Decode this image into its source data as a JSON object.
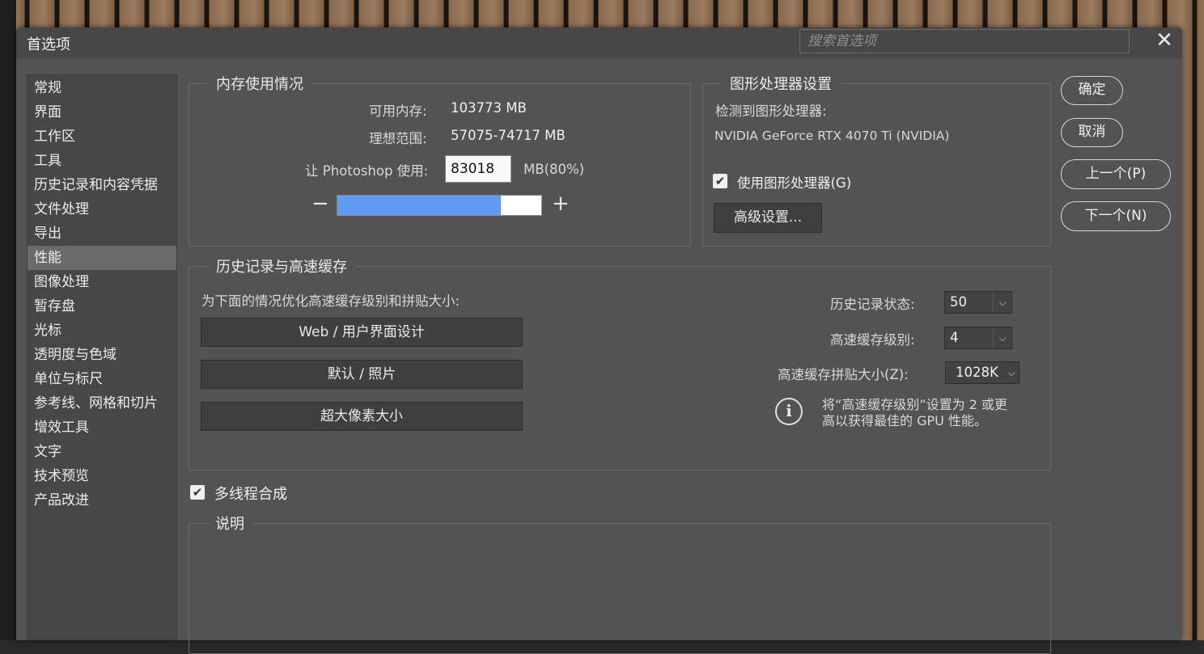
{
  "dialog": {
    "title": "首选项",
    "search_placeholder": "搜索首选项",
    "close_glyph": "✕"
  },
  "sidebar": {
    "items": [
      {
        "label": "常规"
      },
      {
        "label": "界面"
      },
      {
        "label": "工作区"
      },
      {
        "label": "工具"
      },
      {
        "label": "历史记录和内容凭据"
      },
      {
        "label": "文件处理"
      },
      {
        "label": "导出"
      },
      {
        "label": "性能",
        "active": true
      },
      {
        "label": "图像处理"
      },
      {
        "label": "暂存盘"
      },
      {
        "label": "光标"
      },
      {
        "label": "透明度与色域"
      },
      {
        "label": "单位与标尺"
      },
      {
        "label": "参考线、网格和切片"
      },
      {
        "label": "增效工具"
      },
      {
        "label": "文字"
      },
      {
        "label": "技术预览"
      },
      {
        "label": "产品改进"
      }
    ]
  },
  "memory": {
    "legend": "内存使用情况",
    "available_label": "可用内存:",
    "available_value": "103773 MB",
    "ideal_label": "理想范围:",
    "ideal_value": "57075-74717 MB",
    "use_label": "让 Photoshop 使用:",
    "use_value": "83018",
    "use_unit": "MB(80%)",
    "minus": "−",
    "plus": "+",
    "slider_fraction": 0.8
  },
  "gpu": {
    "legend": "图形处理器设置",
    "detected_label": "检测到图形处理器:",
    "gpu_name": "NVIDIA GeForce RTX 4070 Ti (NVIDIA)",
    "use_gpu_label": "使用图形处理器(G)",
    "use_gpu_checked": true,
    "advanced_button": "高级设置..."
  },
  "history_cache": {
    "legend": "历史记录与高速缓存",
    "optimize_label": "为下面的情况优化高速缓存级别和拼贴大小:",
    "preset_buttons": [
      "Web / 用户界面设计",
      "默认 / 照片",
      "超大像素大小"
    ],
    "history_states_label": "历史记录状态:",
    "history_states_value": "50",
    "cache_levels_label": "高速缓存级别:",
    "cache_levels_value": "4",
    "tile_size_label": "高速缓存拼贴大小(Z):",
    "tile_size_value": "1028K",
    "info_line1": "将“高速缓存级别”设置为 2 或更",
    "info_line2": "高以获得最佳的 GPU 性能。"
  },
  "multithread": {
    "label": "多线程合成",
    "checked": true
  },
  "description": {
    "legend": "说明"
  },
  "actions": {
    "ok": "确定",
    "cancel": "取消",
    "prev": "上一个(P)",
    "next": "下一个(N)"
  },
  "check_glyph": "✔",
  "select_arrow": "⌵",
  "info_glyph": "i"
}
